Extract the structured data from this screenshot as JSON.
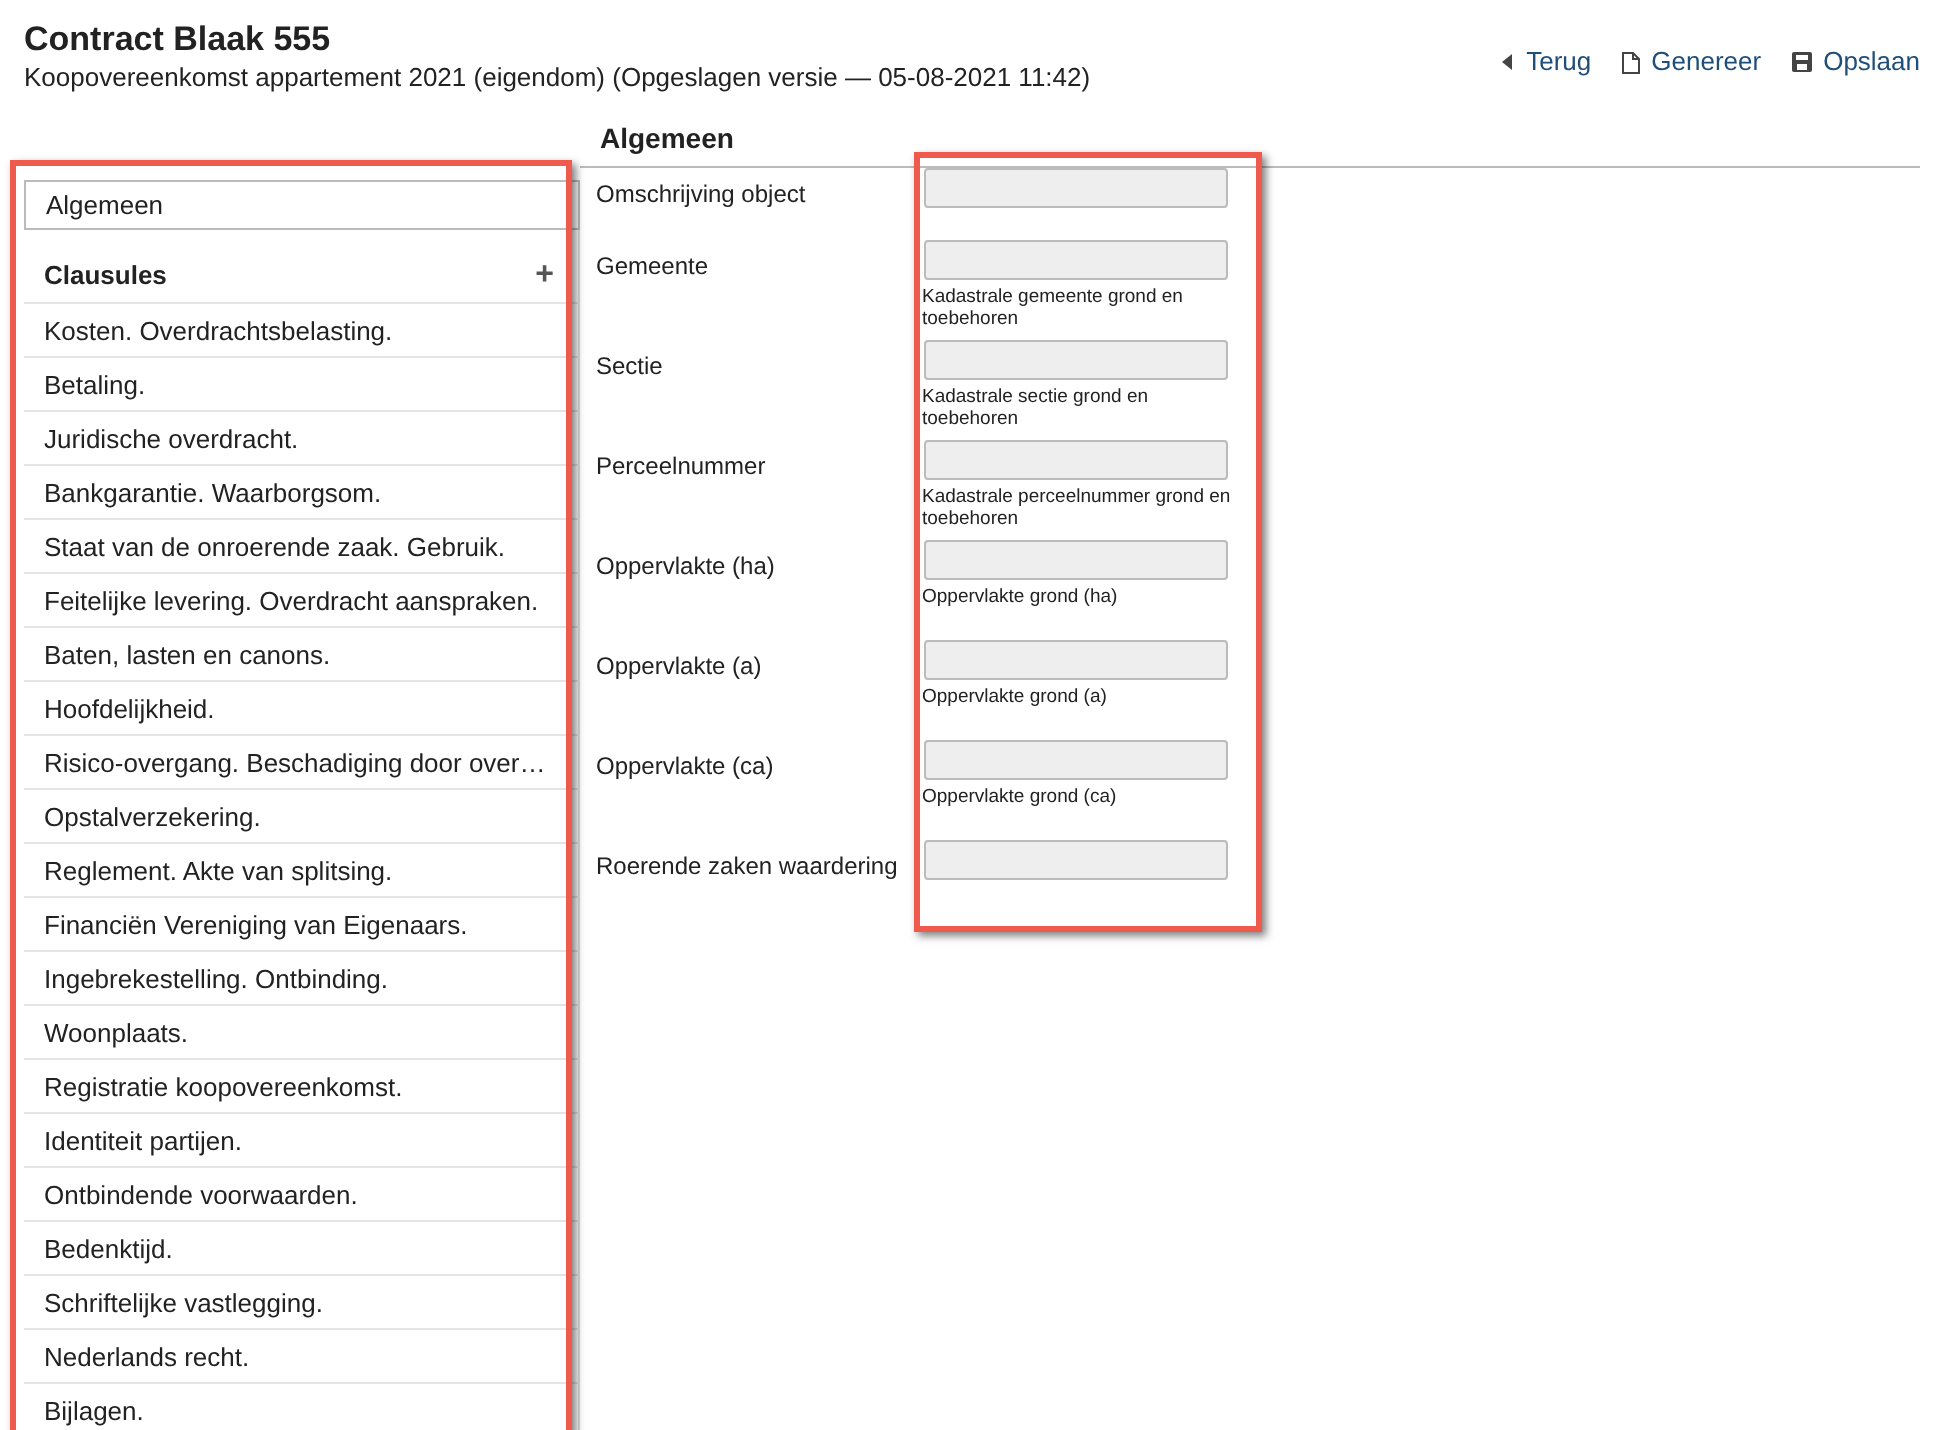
{
  "header": {
    "title": "Contract Blaak 555",
    "subtitle": "Koopovereenkomst appartement 2021 (eigendom) (Opgeslagen versie — 05-08-2021 11:42)",
    "actions": [
      {
        "kind": "back",
        "label": "Terug"
      },
      {
        "kind": "generate",
        "label": "Genereer"
      },
      {
        "kind": "save",
        "label": "Opslaan"
      }
    ]
  },
  "sidebar": {
    "general_item": {
      "label": "Algemeen",
      "selected": true
    },
    "section_title": "Clausules",
    "add_symbol": "+",
    "items": [
      {
        "label": "Kosten. Overdrachtsbelasting."
      },
      {
        "label": "Betaling."
      },
      {
        "label": "Juridische overdracht."
      },
      {
        "label": "Bankgarantie. Waarborgsom."
      },
      {
        "label": "Staat van de onroerende zaak. Gebruik."
      },
      {
        "label": "Feitelijke levering. Overdracht aanspraken."
      },
      {
        "label": "Baten, lasten en canons."
      },
      {
        "label": "Hoofdelijkheid."
      },
      {
        "label": "Risico-overgang. Beschadiging door over…"
      },
      {
        "label": "Opstalverzekering."
      },
      {
        "label": "Reglement. Akte van splitsing."
      },
      {
        "label": "Financiën Vereniging van Eigenaars."
      },
      {
        "label": "Ingebrekestelling. Ontbinding."
      },
      {
        "label": "Woonplaats."
      },
      {
        "label": "Registratie koopovereenkomst."
      },
      {
        "label": "Identiteit partijen."
      },
      {
        "label": "Ontbindende voorwaarden."
      },
      {
        "label": "Bedenktijd."
      },
      {
        "label": "Schriftelijke vastlegging."
      },
      {
        "label": "Nederlands recht."
      },
      {
        "label": "Bijlagen."
      }
    ]
  },
  "form": {
    "title": "Algemeen",
    "fields": [
      {
        "label": "Omschrijving object"
      },
      {
        "label": "Gemeente",
        "hint": "Kadastrale gemeente grond en toebehoren"
      },
      {
        "label": "Sectie",
        "hint": "Kadastrale sectie grond en toebehoren"
      },
      {
        "label": "Perceelnummer",
        "hint": "Kadastrale perceelnummer grond en toebehoren"
      },
      {
        "label": "Oppervlakte (ha)",
        "hint": "Oppervlakte grond (ha)"
      },
      {
        "label": "Oppervlakte (a)",
        "hint": "Oppervlakte grond (a)"
      },
      {
        "label": "Oppervlakte (ca)",
        "hint": "Oppervlakte grond (ca)"
      },
      {
        "label": "Roerende zaken waardering"
      }
    ]
  }
}
